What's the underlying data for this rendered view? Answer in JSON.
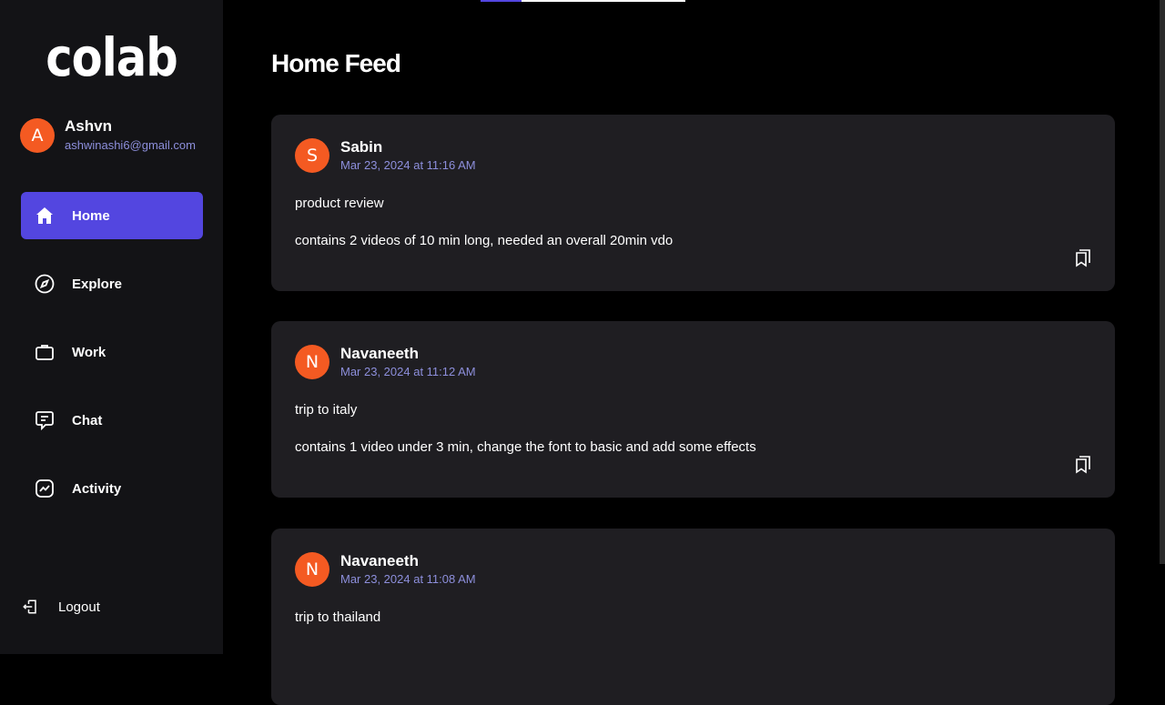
{
  "app": {
    "logo": "colab"
  },
  "user": {
    "initial": "A",
    "name": "Ashvn",
    "email": "ashwinashi6@gmail.com"
  },
  "nav": [
    {
      "label": "Home",
      "icon": "home-icon",
      "active": true
    },
    {
      "label": "Explore",
      "icon": "compass-icon",
      "active": false
    },
    {
      "label": "Work",
      "icon": "briefcase-icon",
      "active": false
    },
    {
      "label": "Chat",
      "icon": "chat-icon",
      "active": false
    },
    {
      "label": "Activity",
      "icon": "activity-icon",
      "active": false
    }
  ],
  "logout": {
    "label": "Logout",
    "icon": "logout-icon"
  },
  "main": {
    "title": "Home Feed"
  },
  "posts": [
    {
      "initial": "S",
      "author": "Sabin",
      "date": "Mar 23, 2024 at 11:16 AM",
      "title": "product review",
      "description": "contains 2 videos of 10 min long, needed an overall 20min vdo"
    },
    {
      "initial": "N",
      "author": "Navaneeth",
      "date": "Mar 23, 2024 at 11:12 AM",
      "title": "trip to italy",
      "description": "contains 1 video under 3 min, change the font to basic and add some effects"
    },
    {
      "initial": "N",
      "author": "Navaneeth",
      "date": "Mar 23, 2024 at 11:08 AM",
      "title": "trip to thailand",
      "description": ""
    }
  ],
  "colors": {
    "accent": "#5346e0",
    "avatar": "#f45a22",
    "sidebar": "#131316",
    "card": "#1f1e22",
    "meta": "#8d8fdc"
  }
}
